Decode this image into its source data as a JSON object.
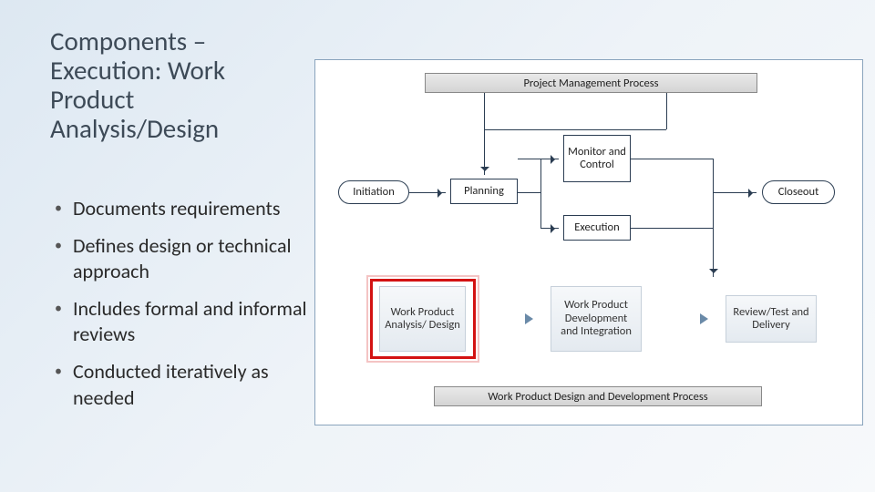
{
  "title": "Components – Execution: Work Product Analysis/Design",
  "bullets": [
    "Documents requirements",
    "Defines design or technical approach",
    "Includes formal and informal reviews",
    "Conducted iteratively as needed"
  ],
  "diagram": {
    "top_header": "Project Management Process",
    "bottom_header": "Work Product Design and Development Process",
    "phases": {
      "initiation": "Initiation",
      "planning": "Planning",
      "monitor": "Monitor and Control",
      "execution": "Execution",
      "closeout": "Closeout"
    },
    "sub": {
      "analysis": "Work Product Analysis/ Design",
      "dev": "Work Product Development and Integration",
      "review": "Review/Test and Delivery"
    }
  }
}
